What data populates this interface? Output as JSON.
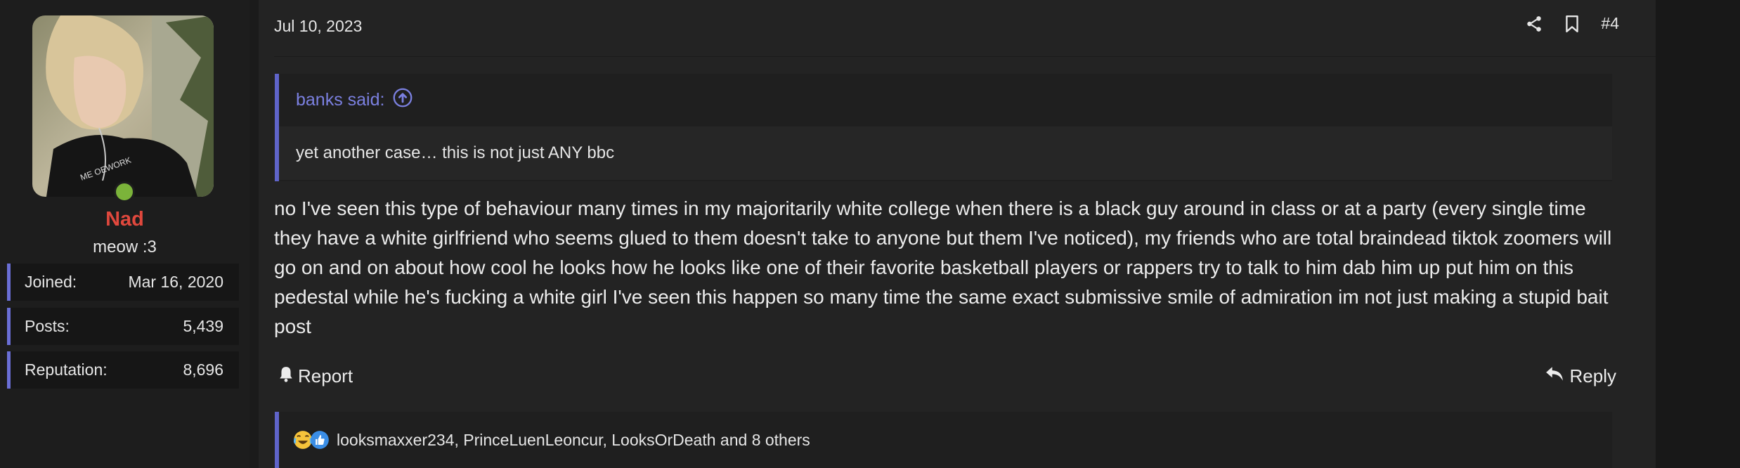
{
  "user": {
    "name": "Nad",
    "title": "meow :3",
    "online": true,
    "stats": [
      {
        "label": "Joined:",
        "value": "Mar 16, 2020"
      },
      {
        "label": "Posts:",
        "value": "5,439"
      },
      {
        "label": "Reputation:",
        "value": "8,696"
      }
    ]
  },
  "post": {
    "date": "Jul 10, 2023",
    "number": "#4",
    "quote": {
      "author_line": "banks said:",
      "text": "yet another case… this is not just ANY bbc"
    },
    "message": "no I've seen this type of behaviour many times in my majoritarily white college when there is a black guy around in class or at a party (every single time they have a white girlfriend who seems glued to them doesn't take to anyone but them I've noticed), my friends who are total braindead tiktok zoomers will go on and on about how cool he looks how he looks like one of their favorite basketball players or rappers try to talk to him dab him up put him on this pedestal while he's fucking a white girl I've seen this happen so many time the same exact submissive smile of admiration im not just making a stupid bait post",
    "actions": {
      "report_label": "Report",
      "reply_label": "Reply"
    },
    "reactions_text": "looksmaxxer234, PrinceLuenLeoncur, LooksOrDeath and 8 others"
  },
  "colors": {
    "accent": "#6a6fd6",
    "username": "#e0483d",
    "online": "#7bb33a"
  },
  "icons": [
    "share-icon",
    "bookmark-icon",
    "up-arrow-circle-icon",
    "bell-icon",
    "reply-arrow-icon",
    "laugh-cry-emoji-icon",
    "thumbs-up-icon"
  ]
}
